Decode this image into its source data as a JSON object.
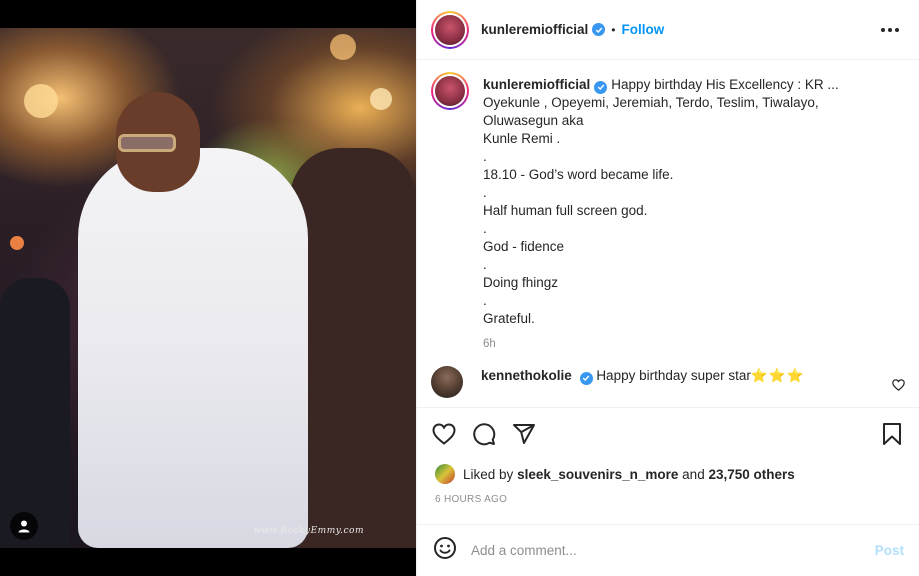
{
  "post": {
    "photo_watermark": "www.RockyEmmy.com"
  },
  "header": {
    "username": "kunleremiofficial",
    "separator": "•",
    "follow_label": "Follow"
  },
  "caption": {
    "username": "kunleremiofficial",
    "text": "Happy birthday His Excellency : KR ...\nOyekunle , Opeyemi, Jeremiah, Terdo, Teslim, Tiwalayo,\nOluwasegun aka\nKunle Remi .\n.\n18.10 - God’s word became life.\n.\nHalf human full screen god.\n.\nGod - fidence\n.\nDoing fhingz\n.\nGrateful.",
    "time": "6h"
  },
  "comments": [
    {
      "username": "kennethokolie",
      "text": "Happy birthday super star",
      "stars": "⭐⭐⭐"
    }
  ],
  "likes": {
    "prefix": "Liked by",
    "user": "sleek_souvenirs_n_more",
    "joiner": "and",
    "others": "23,750 others"
  },
  "posted_ago": "6 HOURS AGO",
  "add_comment": {
    "placeholder": "Add a comment...",
    "post_label": "Post"
  },
  "colors": {
    "accent": "#0095f6",
    "verified": "#3897f0",
    "post_disabled": "#b2dffc"
  }
}
